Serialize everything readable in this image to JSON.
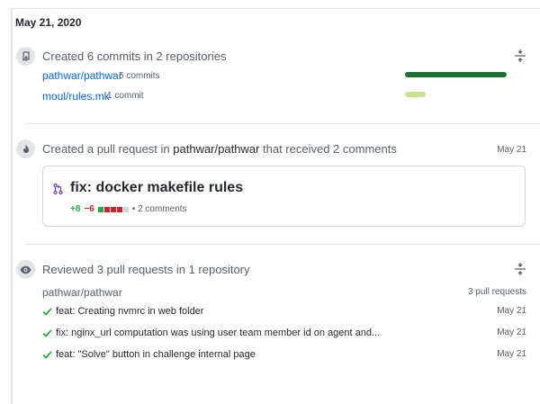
{
  "date_heading": "May 21, 2020",
  "commits": {
    "title": "Created 6 commits in 2 repositories",
    "icon": "repo-push-icon",
    "repos": [
      {
        "name": "pathwar/pathwar",
        "count": "5 commits",
        "share": 0.83,
        "bar_color": "#216e39"
      },
      {
        "name": "moul/rules.mk",
        "count": "1 commit",
        "share": 0.17,
        "bar_color": "#c6e48b"
      }
    ]
  },
  "pull_request": {
    "title_prefix": "Created a pull request in ",
    "repo": "pathwar/pathwar",
    "title_suffix": " that received 2 comments",
    "date": "May 21",
    "icon": "flame-icon",
    "card": {
      "title": "fix: docker makefile rules",
      "additions": "+8",
      "deletions": "−6",
      "comments": "• 2 comments",
      "diffstat": [
        "#28a745",
        "#cb2431",
        "#cb2431",
        "#cb2431",
        "#d1d5da"
      ]
    }
  },
  "reviews": {
    "title": "Reviewed 3 pull requests in 1 repository",
    "icon": "eye-icon",
    "repo": "pathwar/pathwar",
    "count": "3 pull requests",
    "items": [
      {
        "label": "feat: Creating nvmrc in web folder",
        "date": "May 21"
      },
      {
        "label": "fix: nginx_url computation was using user team member id on agent and...",
        "date": "May 21"
      },
      {
        "label": "feat: \"Solve\" button in challenge internal page",
        "date": "May 21"
      }
    ]
  }
}
